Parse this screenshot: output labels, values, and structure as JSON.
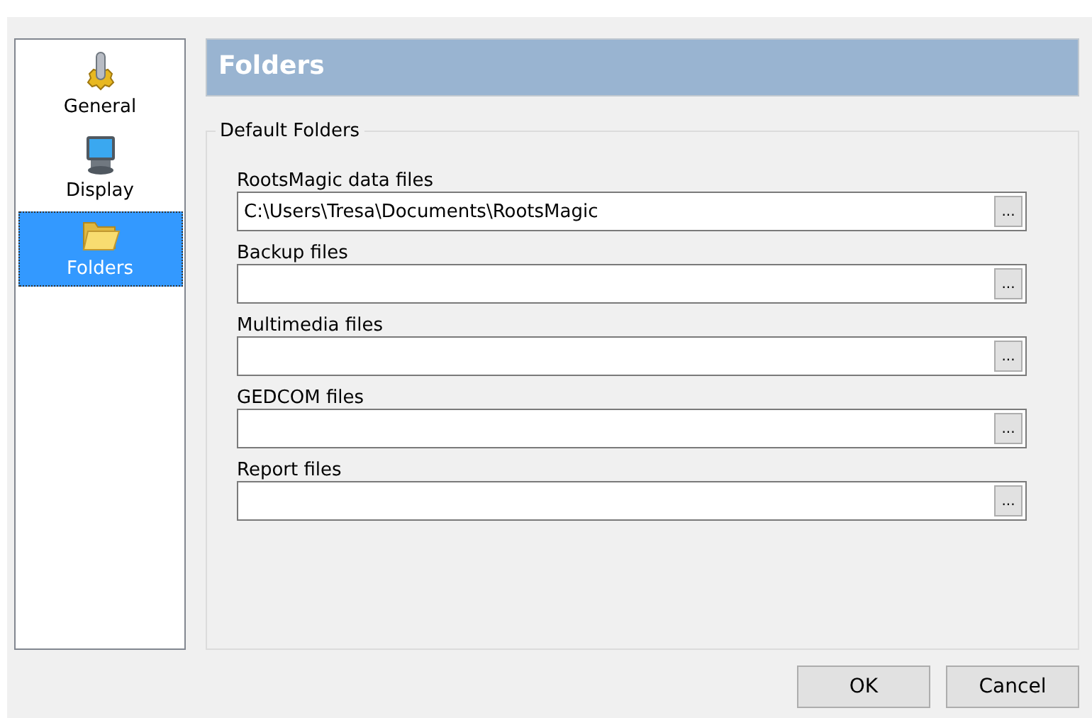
{
  "sidebar": {
    "items": [
      {
        "label": "General",
        "selected": false
      },
      {
        "label": "Display",
        "selected": false
      },
      {
        "label": "Folders",
        "selected": true
      }
    ]
  },
  "header": {
    "title": "Folders"
  },
  "group": {
    "title": "Default Folders",
    "fields": [
      {
        "label": "RootsMagic data files",
        "value": "C:\\Users\\Tresa\\Documents\\RootsMagic",
        "browse": "..."
      },
      {
        "label": "Backup files",
        "browse": "..."
      },
      {
        "label": "Multimedia files",
        "browse": "..."
      },
      {
        "label": "GEDCOM files",
        "browse": "..."
      },
      {
        "label": "Report files",
        "browse": "..."
      }
    ]
  },
  "buttons": [
    "OK",
    "Cancel"
  ]
}
